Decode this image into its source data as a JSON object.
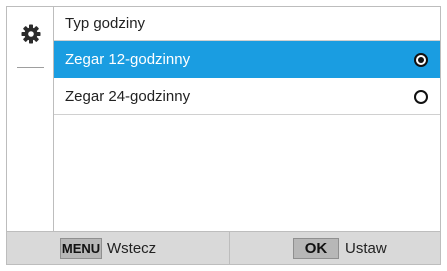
{
  "menu": {
    "title": "Typ godziny",
    "options": [
      {
        "label": "Zegar 12-godzinny",
        "selected": true
      },
      {
        "label": "Zegar 24-godzinny",
        "selected": false
      }
    ]
  },
  "sidebar": {
    "icon": "gear-icon"
  },
  "footer": {
    "back_key": "MENU",
    "back_label": "Wstecz",
    "ok_key": "OK",
    "ok_label": "Ustaw"
  },
  "colors": {
    "accent": "#1a9de1",
    "footer_bg": "#d9d9d9",
    "key_bg": "#b7b7b7"
  }
}
